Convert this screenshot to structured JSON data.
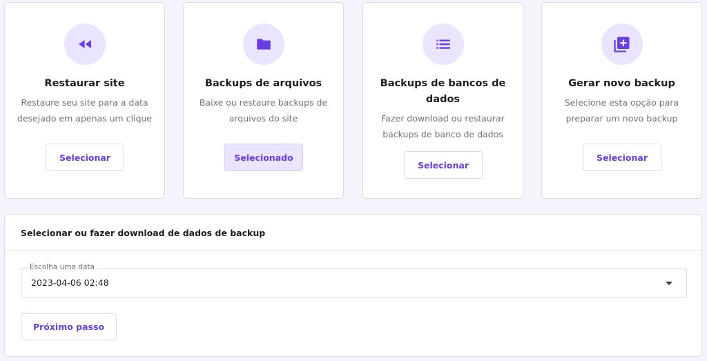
{
  "cards": [
    {
      "title": "Restaurar site",
      "desc_line1": "Restaure seu site para a data",
      "desc_line2": "desejado em apenas um clique",
      "button": "Selecionar",
      "icon": "rewind-icon"
    },
    {
      "title": "Backups de arquivos",
      "desc_line1": "Baixe ou restaure backups de",
      "desc_line2": "arquivos do site",
      "button": "Selecionado",
      "icon": "folder-icon"
    },
    {
      "title_line1": "Backups de bancos de",
      "title_line2": "dados",
      "desc_line1": "Fazer download ou restaurar",
      "desc_line2": "backups de banco de dados",
      "button": "Selecionar",
      "icon": "list-icon"
    },
    {
      "title": "Gerar novo backup",
      "desc_line1": "Selecione esta opção para",
      "desc_line2": "preparar um novo backup",
      "button": "Selecionar",
      "icon": "add-box-icon"
    }
  ],
  "panel": {
    "title": "Selecionar ou fazer download de dados de backup",
    "date_label": "Escolha uma data",
    "date_value": "2023-04-06 02:48",
    "next_button": "Próximo passo"
  },
  "colors": {
    "accent": "#673de6",
    "accent_light": "#ebe4ff",
    "background": "#f4f4fd",
    "text_dark": "#1d1e20",
    "text_muted": "#6d7081"
  }
}
